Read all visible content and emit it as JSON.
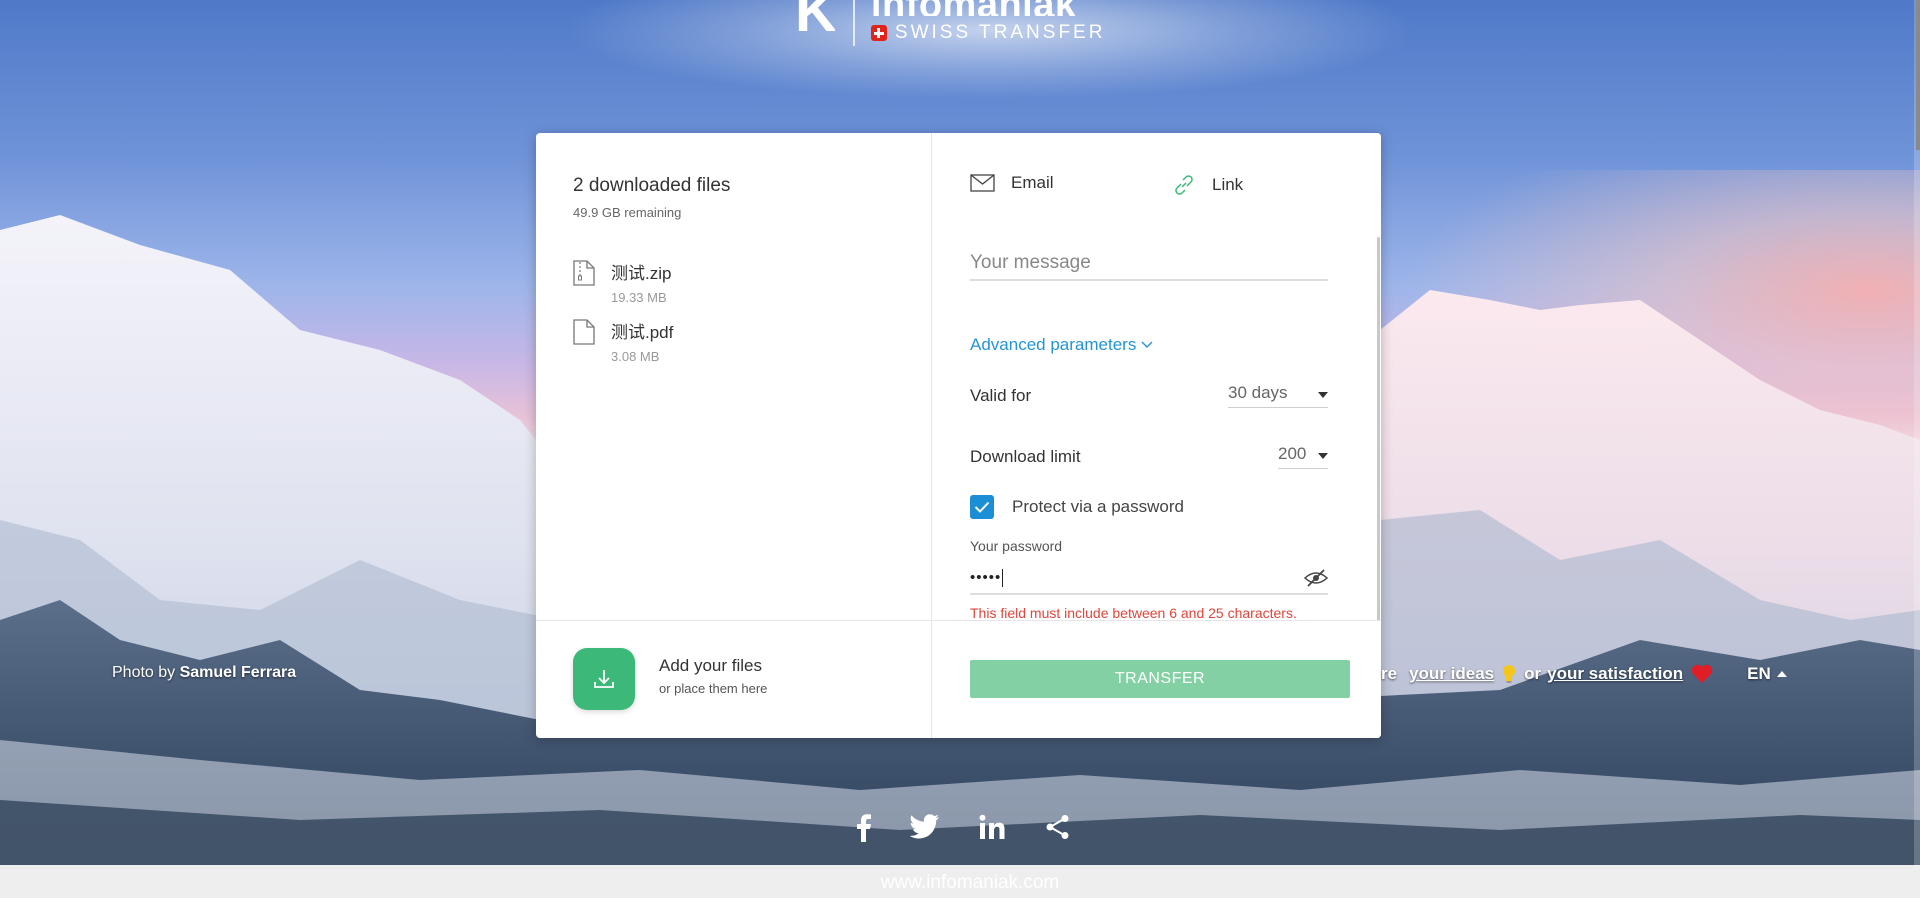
{
  "logo": {
    "k": "K",
    "brand": "infomaniak",
    "product": "SWISS TRANSFER"
  },
  "files": {
    "title": "2 downloaded files",
    "remaining": "49.9 GB remaining",
    "items": [
      {
        "name": "测试.zip",
        "size": "19.33 MB",
        "icon": "zip-file-icon"
      },
      {
        "name": "测试.pdf",
        "size": "3.08 MB",
        "icon": "file-icon"
      }
    ]
  },
  "add_files": {
    "title": "Add your files",
    "subtitle": "or place them here"
  },
  "tabs": [
    {
      "label": "Email",
      "icon": "mail-icon"
    },
    {
      "label": "Link",
      "icon": "link-icon"
    }
  ],
  "message": {
    "placeholder": "Your message",
    "value": ""
  },
  "advanced": {
    "label": "Advanced parameters"
  },
  "params": {
    "valid_for": {
      "label": "Valid for",
      "value": "30 days"
    },
    "download_limit": {
      "label": "Download limit",
      "value": "200"
    }
  },
  "password": {
    "checkbox_label": "Protect via a password",
    "checked": true,
    "field_label": "Your password",
    "value": "•••••",
    "error": "This field must include between 6 and 25 characters."
  },
  "transfer_button": "TRANSFER",
  "photo_credit": {
    "prefix": "Photo by",
    "author": "Samuel Ferrara"
  },
  "share": {
    "prefix": "re",
    "ideas": "your ideas",
    "or": "or",
    "satisfaction": "your satisfaction",
    "lang": "EN"
  },
  "footer_url": "www.infomaniak.com",
  "colors": {
    "accent_green": "#3cb878",
    "accent_blue": "#2594d6",
    "error_red": "#e0463b"
  }
}
